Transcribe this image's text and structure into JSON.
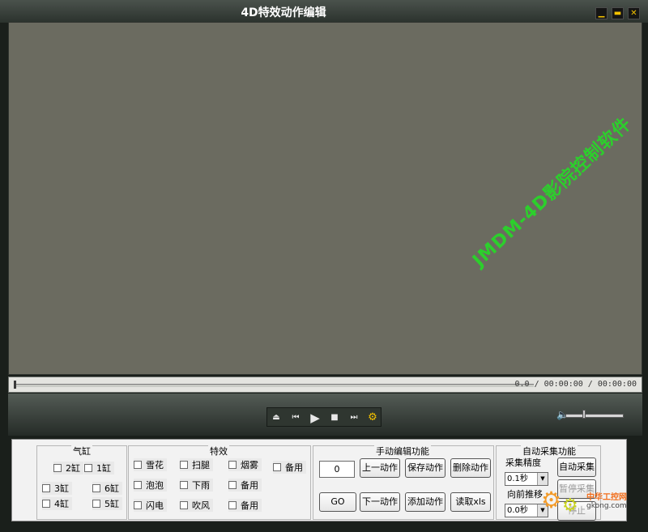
{
  "window": {
    "title": "4D特效动作编辑",
    "min": "▁",
    "max": "▬",
    "close": "✕"
  },
  "video": {
    "watermark": "JMDM-4D影院控制软件"
  },
  "seek": {
    "time": "0.0 / 00:00:00 / 00:00:00",
    "progress": 0
  },
  "player": {
    "eject": "⏏",
    "prev": "⏮",
    "play": "▶",
    "stop": "■",
    "next": "⏭",
    "settings": "⚙",
    "volume_icon": "🔈",
    "volume_level": 0.3
  },
  "cylinders": {
    "title": "气缸",
    "items": [
      "2缸",
      "1缸",
      "3缸",
      "6缸",
      "4缸",
      "5缸"
    ]
  },
  "effects": {
    "title": "特效",
    "items": [
      "雪花",
      "扫腿",
      "烟雾",
      "备用",
      "泡泡",
      "下雨",
      "备用",
      "闪电",
      "吹风",
      "备用"
    ]
  },
  "manual": {
    "title": "手动编辑功能",
    "frame_value": "0",
    "prev_action": "上一动作",
    "save_action": "保存动作",
    "delete_action": "删除动作",
    "go": "GO",
    "next_action": "下一动作",
    "add_action": "添加动作",
    "read_xls": "读取xls"
  },
  "auto": {
    "title": "自动采集功能",
    "precision_label": "采集精度",
    "precision_value": "0.1秒",
    "forward_label": "向前推移",
    "forward_value": "0.0秒",
    "auto_collect": "自动采集",
    "pause_collect": "暂停采集",
    "stop_collect": "停止"
  },
  "logo": {
    "brand": "中华工控网",
    "url": "gkong.com"
  },
  "colors": {
    "watermark": "#2ccf2c",
    "video_bg": "#6b6b60",
    "logo_orange": "#f26d1a"
  }
}
